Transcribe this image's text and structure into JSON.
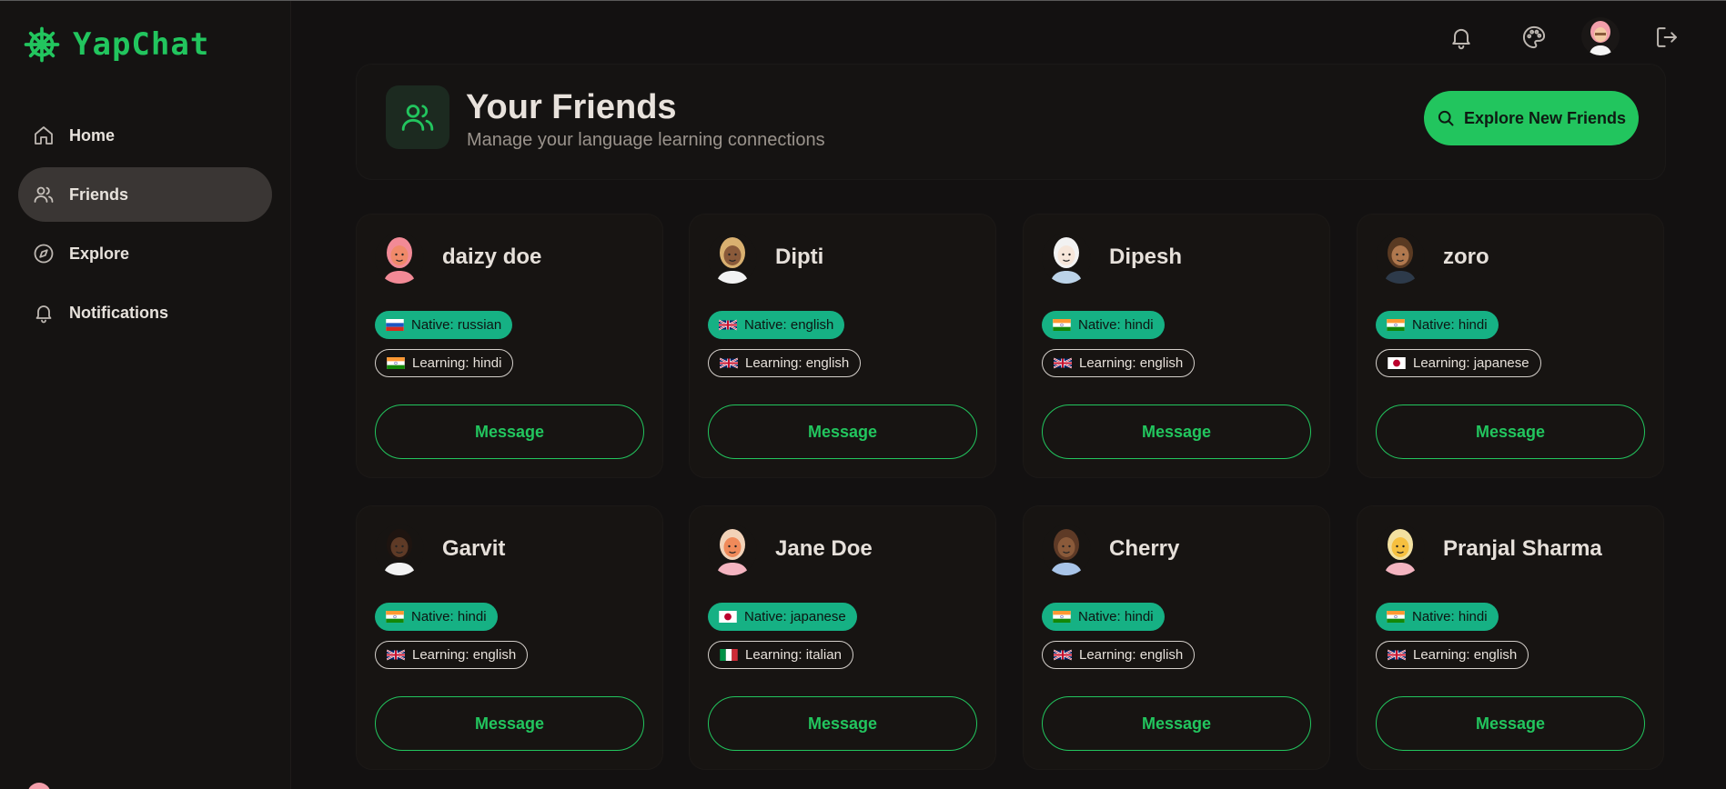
{
  "app": {
    "name": "YapChat"
  },
  "sidebar": {
    "items": [
      {
        "label": "Home",
        "icon": "home-icon"
      },
      {
        "label": "Friends",
        "icon": "users-icon",
        "active": true
      },
      {
        "label": "Explore",
        "icon": "compass-icon"
      },
      {
        "label": "Notifications",
        "icon": "bell-icon"
      }
    ]
  },
  "topbar": {
    "icons": [
      "bell-icon",
      "palette-icon",
      "avatar",
      "logout-icon"
    ]
  },
  "header": {
    "title": "Your Friends",
    "subtitle": "Manage your language learning connections",
    "explore_button": "Explore New Friends"
  },
  "friends": [
    {
      "name": "daizy doe",
      "native": "Native: russian",
      "native_flag": "ru",
      "learning": "Learning: hindi",
      "learning_flag": "in",
      "button": "Message"
    },
    {
      "name": "Dipti",
      "native": "Native: english",
      "native_flag": "gb",
      "learning": "Learning: english",
      "learning_flag": "gb",
      "button": "Message"
    },
    {
      "name": "Dipesh",
      "native": "Native: hindi",
      "native_flag": "in",
      "learning": "Learning: english",
      "learning_flag": "gb",
      "button": "Message"
    },
    {
      "name": "zoro",
      "native": "Native: hindi",
      "native_flag": "in",
      "learning": "Learning: japanese",
      "learning_flag": "jp",
      "button": "Message"
    },
    {
      "name": "Garvit",
      "native": "Native: hindi",
      "native_flag": "in",
      "learning": "Learning: english",
      "learning_flag": "gb",
      "button": "Message"
    },
    {
      "name": "Jane Doe",
      "native": "Native: japanese",
      "native_flag": "jp",
      "learning": "Learning: italian",
      "learning_flag": "it",
      "button": "Message"
    },
    {
      "name": "Cherry",
      "native": "Native: hindi",
      "native_flag": "in",
      "learning": "Learning: english",
      "learning_flag": "gb",
      "button": "Message"
    },
    {
      "name": "Pranjal Sharma",
      "native": "Native: hindi",
      "native_flag": "in",
      "learning": "Learning: english",
      "learning_flag": "gb",
      "button": "Message"
    }
  ],
  "colors": {
    "accent": "#22c55e",
    "native_badge": "#16b184",
    "background": "#131111",
    "card": "#171412"
  }
}
